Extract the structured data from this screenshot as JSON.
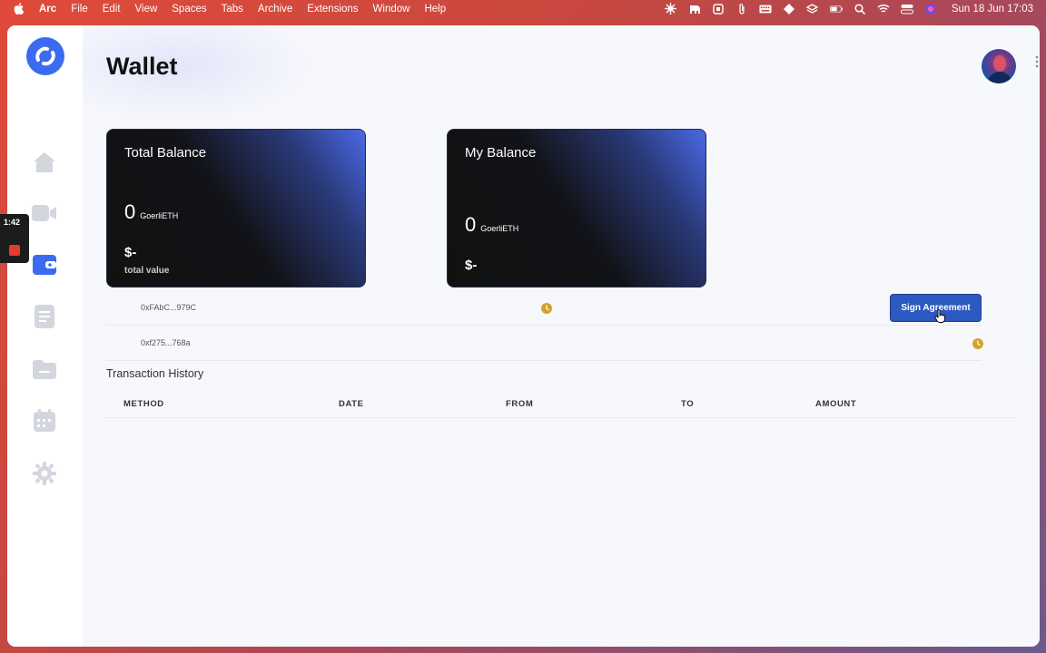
{
  "menubar": {
    "app": "Arc",
    "items": [
      "File",
      "Edit",
      "View",
      "Spaces",
      "Tabs",
      "Archive",
      "Extensions",
      "Window",
      "Help"
    ],
    "clock": "Sun 18 Jun  17:03"
  },
  "recorder": {
    "time": "1:42"
  },
  "page": {
    "title": "Wallet"
  },
  "cards": [
    {
      "title": "Total Balance",
      "amount": "0",
      "unit": "GoerliETH",
      "fiat": "$-",
      "caption": "total value"
    },
    {
      "title": "My Balance",
      "amount": "0",
      "unit": "GoerliETH",
      "fiat": "$-"
    }
  ],
  "addresses": [
    {
      "address": "0xFAbC...979C",
      "status": "pending"
    },
    {
      "address": "0xf275...768a",
      "status": "pending"
    }
  ],
  "sign_button": "Sign Agreement",
  "transactions": {
    "title": "Transaction History",
    "columns": [
      "METHOD",
      "DATE",
      "FROM",
      "TO",
      "AMOUNT"
    ]
  },
  "colors": {
    "accent": "#2d5ac0",
    "nav_active": "#3b6cf0",
    "pending": "#d4a22a"
  },
  "icons": {
    "nav": [
      "home-icon",
      "video-icon",
      "wallet-icon",
      "document-icon",
      "folder-icon",
      "calendar-icon",
      "gear-icon"
    ]
  }
}
